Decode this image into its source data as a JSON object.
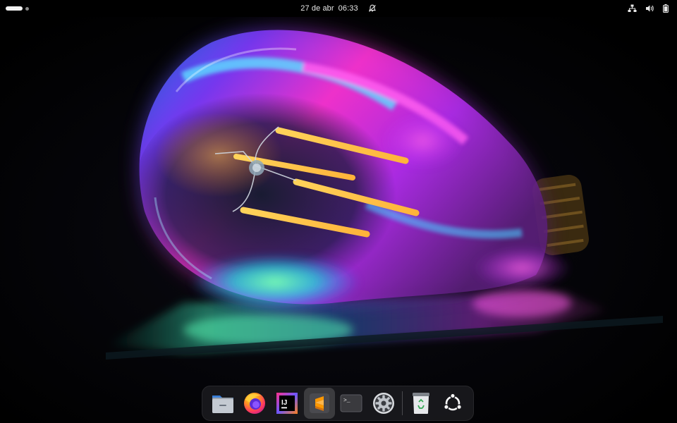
{
  "topbar": {
    "date": "27 de abr",
    "time": "06:33",
    "status_icons": [
      "network-wired-icon",
      "volume-icon",
      "battery-icon"
    ],
    "notification_icon": "notifications-disabled-icon"
  },
  "wallpaper": {
    "subject": "light-bulb-icon",
    "colors": [
      "#ff2fd2",
      "#8a3cff",
      "#2fd9ff",
      "#4dff8a",
      "#ffc94a"
    ]
  },
  "dock": {
    "focused": "sublime-text",
    "items": [
      {
        "id": "files",
        "icon": "files-folder-icon"
      },
      {
        "id": "firefox",
        "icon": "firefox-icon"
      },
      {
        "id": "intellij",
        "icon": "intellij-idea-icon",
        "glyph": "IJ"
      },
      {
        "id": "sublime-text",
        "icon": "sublime-text-icon"
      },
      {
        "id": "terminal",
        "icon": "terminal-icon",
        "glyph": ">_"
      },
      {
        "id": "settings",
        "icon": "gear-icon"
      },
      {
        "id": "trash",
        "icon": "trash-icon"
      },
      {
        "id": "show-apps",
        "icon": "ubuntu-logo-icon"
      }
    ]
  }
}
